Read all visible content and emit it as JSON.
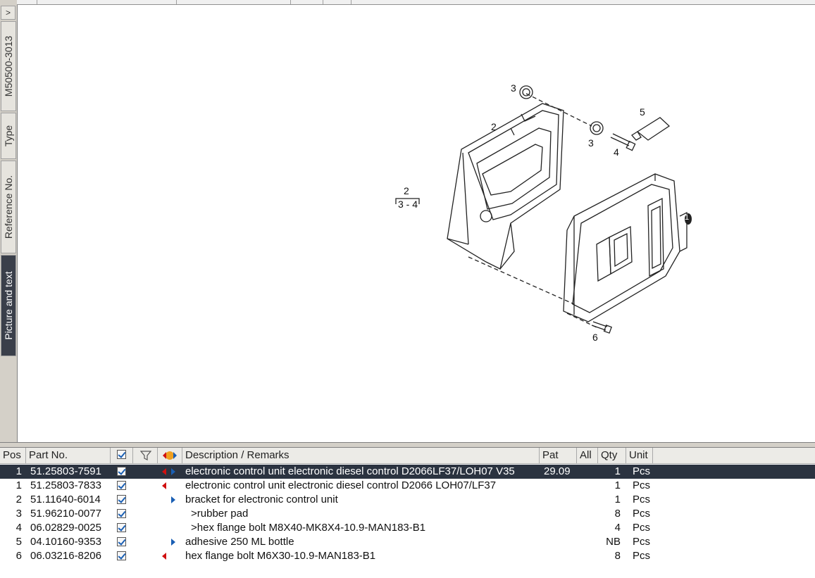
{
  "side_tabs": {
    "toggle": ">",
    "items": [
      "M50500-3013",
      "Type",
      "Reference No.",
      "Picture and text"
    ],
    "active": "Picture and text"
  },
  "drawing": {
    "callouts": {
      "c1": "1",
      "c2": "2",
      "c2b": "2",
      "c3_range": "3 - 4",
      "c3a": "3",
      "c3b": "3",
      "c4": "4",
      "c5": "5",
      "c6": "6"
    }
  },
  "table": {
    "headers": {
      "pos": "Pos",
      "part_no": "Part No.",
      "description": "Description / Remarks",
      "pat": "Pat",
      "all": "All",
      "qty": "Qty",
      "unit": "Unit"
    },
    "rows": [
      {
        "pos": "1",
        "part_no": "51.25803-7591",
        "arrows": "both",
        "description": "electronic control unit electronic diesel control D2066LF37/LOH07 V35",
        "pat": "29.09",
        "qty": "1",
        "unit": "Pcs"
      },
      {
        "pos": "1",
        "part_no": "51.25803-7833",
        "arrows": "left",
        "description": "electronic control unit electronic diesel control D2066 LOH07/LF37",
        "pat": "",
        "qty": "1",
        "unit": "Pcs"
      },
      {
        "pos": "2",
        "part_no": "51.11640-6014",
        "arrows": "right",
        "description": "bracket for electronic control unit",
        "pat": "",
        "qty": "1",
        "unit": "Pcs"
      },
      {
        "pos": "3",
        "part_no": "51.96210-0077",
        "arrows": "none",
        "description": ">rubber pad",
        "pat": "",
        "qty": "8",
        "unit": "Pcs"
      },
      {
        "pos": "4",
        "part_no": "06.02829-0025",
        "arrows": "none",
        "description": ">hex flange bolt M8X40-MK8X4-10.9-MAN183-B1",
        "pat": "",
        "qty": "4",
        "unit": "Pcs"
      },
      {
        "pos": "5",
        "part_no": "04.10160-9353",
        "arrows": "right",
        "description": "adhesive 250 ML bottle",
        "pat": "",
        "qty": "NB",
        "unit": "Pcs"
      },
      {
        "pos": "6",
        "part_no": "06.03216-8206",
        "arrows": "left",
        "description": "hex flange bolt M6X30-10.9-MAN183-B1",
        "pat": "",
        "qty": "8",
        "unit": "Pcs"
      }
    ]
  },
  "colors": {
    "selected_row": "#2b3340",
    "arrow_left": "#d01010",
    "arrow_right": "#1a5fb4",
    "tab_active": "#3a3f4a"
  }
}
